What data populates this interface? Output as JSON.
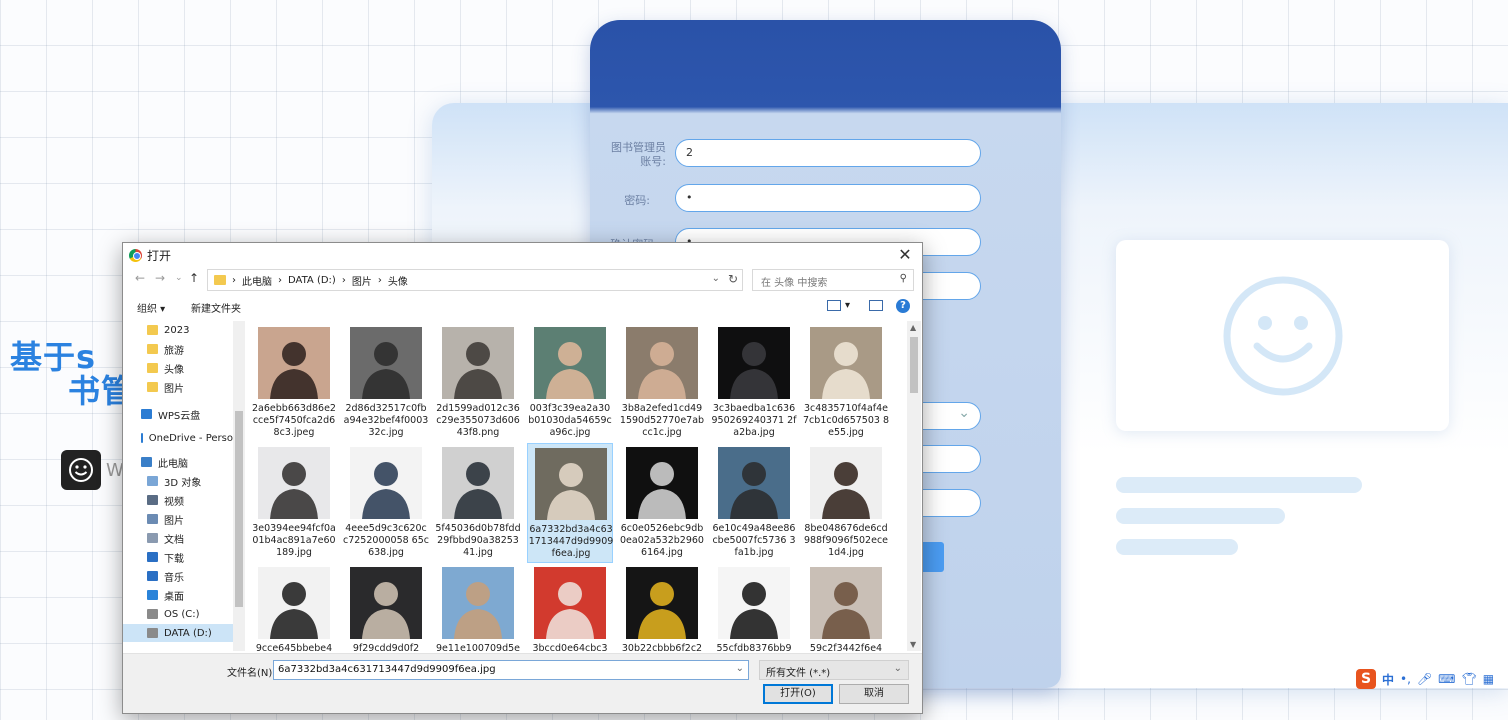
{
  "page": {
    "title_line1": "基于s",
    "title_line2": "书管",
    "title_w": "W"
  },
  "form": {
    "account_label": "图书管理员账号:",
    "account_value": "2",
    "password_label": "密码:",
    "password_value": "•",
    "confirm_label": "确认密码:",
    "confirm_value": "•"
  },
  "dialog": {
    "title": "打开",
    "close": "✕",
    "breadcrumb": [
      "此电脑",
      "DATA (D:)",
      "图片",
      "头像"
    ],
    "search_placeholder": "在 头像 中搜索",
    "organize": "组织 ▾",
    "new_folder": "新建文件夹",
    "help": "?",
    "sidebar": [
      {
        "label": "2023",
        "icon": "folder-icon"
      },
      {
        "label": "旅游",
        "icon": "folder-icon"
      },
      {
        "label": "头像",
        "icon": "folder-icon"
      },
      {
        "label": "图片",
        "icon": "folder-icon"
      },
      {
        "label": "WPS云盘",
        "icon": "cloud-icon"
      },
      {
        "label": "OneDrive - Perso",
        "icon": "cloud-icon"
      },
      {
        "label": "此电脑",
        "icon": "computer-icon"
      },
      {
        "label": "3D 对象",
        "icon": "cube-icon"
      },
      {
        "label": "视频",
        "icon": "video-icon"
      },
      {
        "label": "图片",
        "icon": "picture-icon"
      },
      {
        "label": "文档",
        "icon": "document-icon"
      },
      {
        "label": "下载",
        "icon": "download-icon"
      },
      {
        "label": "音乐",
        "icon": "music-icon"
      },
      {
        "label": "桌面",
        "icon": "desktop-icon"
      },
      {
        "label": "OS (C:)",
        "icon": "drive-icon"
      },
      {
        "label": "DATA (D:)",
        "icon": "drive-icon"
      }
    ],
    "files": [
      {
        "name": "2a6ebb663d86e2cce5f7450fca2d68c3.jpeg",
        "bg": "#c9a58f",
        "fg": "#2b1f1c"
      },
      {
        "name": "2d86d32517c0fba94e32bef4f000332c.jpg",
        "bg": "#6b6b6b",
        "fg": "#2a2a2a"
      },
      {
        "name": "2d1599ad012c36c29e355073d60643f8.png",
        "bg": "#b7b2ab",
        "fg": "#3b3632"
      },
      {
        "name": "003f3c39ea2a30b01030da54659ca96c.jpg",
        "bg": "#5c7f73",
        "fg": "#e2b89b"
      },
      {
        "name": "3b8a2efed1cd491590d52770e7abcc1c.jpg",
        "bg": "#8b7c6c",
        "fg": "#d9b59a"
      },
      {
        "name": "3c3baedba1c636950269240371 2fa2ba.jpg",
        "bg": "#0f0f10",
        "fg": "#3b3b40"
      },
      {
        "name": "3c4835710f4af4e7cb1c0d657503 8e55.jpg",
        "bg": "#a99a86",
        "fg": "#f1e7d8"
      },
      {
        "name": "3e0394ee94fcf0a01b4ac891a7e60189.jpg",
        "bg": "#e8e8ea",
        "fg": "#2e2b2b"
      },
      {
        "name": "4eee5d9c3c620cc7252000058 65c638.jpg",
        "bg": "#f3f3f3",
        "fg": "#24364f"
      },
      {
        "name": "5f45036d0b78fdd29fbbd90a3825341.jpg",
        "bg": "#d0d0d0",
        "fg": "#222a33"
      },
      {
        "name": "6a7332bd3a4c631713447d9d9909f6ea.jpg",
        "bg": "#6f6b5f",
        "fg": "#e9dccd"
      },
      {
        "name": "6c0e0526ebc9db0ea02a532b29606164.jpg",
        "bg": "#101010",
        "fg": "#d9d9d9"
      },
      {
        "name": "6e10c49a48ee86cbe5007fc5736 3fa1b.jpg",
        "bg": "#4a6d8a",
        "fg": "#2a2a2a"
      },
      {
        "name": "8be048676de6cd988f9096f502ece1d4.jpg",
        "bg": "#efefef",
        "fg": "#2d1f17"
      },
      {
        "name": "9cce645bbebe4",
        "bg": "#f2f2f2",
        "fg": "#1a1a1a"
      },
      {
        "name": "9f29cdd9d0f2",
        "bg": "#2a2a2c",
        "fg": "#d2c6b6"
      },
      {
        "name": "9e11e100709d5e",
        "bg": "#7ea9d1",
        "fg": "#c89f78"
      },
      {
        "name": "3bccd0e64cbc3",
        "bg": "#d23a2e",
        "fg": "#f0e6df"
      },
      {
        "name": "30b22cbbb6f2c2",
        "bg": "#151515",
        "fg": "#e8b61f"
      },
      {
        "name": "55cfdb8376bb9",
        "bg": "#f5f5f5",
        "fg": "#111111"
      },
      {
        "name": "59c2f3442f6e4",
        "bg": "#c9bfb6",
        "fg": "#6a4d3a"
      }
    ],
    "filename_label": "文件名(N):",
    "filename_value": "6a7332bd3a4c631713447d9d9909f6ea.jpg",
    "filetype_value": "所有文件 (*.*)",
    "open_button": "打开(O)",
    "cancel_button": "取消"
  },
  "ime": {
    "logo": "S",
    "lang": "中"
  }
}
